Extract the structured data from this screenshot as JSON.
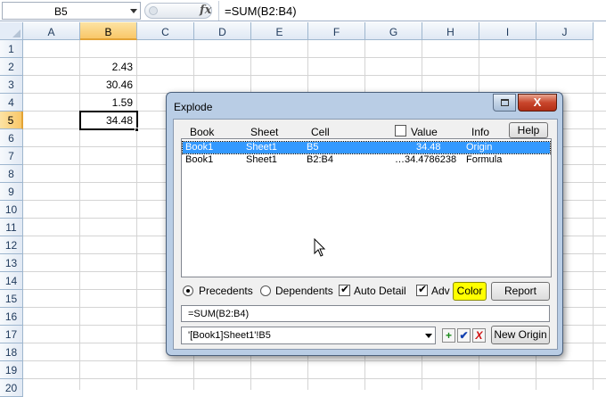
{
  "formula_bar": {
    "name_box": "B5",
    "fx_label": "fx",
    "formula": "=SUM(B2:B4)"
  },
  "sheet": {
    "columns": [
      "A",
      "B",
      "C",
      "D",
      "E",
      "F",
      "G",
      "H",
      "I",
      "J"
    ],
    "selected_column": "B",
    "rows": [
      "1",
      "2",
      "3",
      "4",
      "5",
      "6",
      "7",
      "8",
      "9",
      "10",
      "11",
      "12",
      "13",
      "14",
      "15",
      "16",
      "17",
      "18",
      "19",
      "20"
    ],
    "selected_row": "5",
    "cells": {
      "B2": "2.43",
      "B3": "30.46",
      "B4": "1.59",
      "B5": "34.48"
    }
  },
  "dialog": {
    "title": "Explode",
    "close_glyph": "X",
    "headers": {
      "book": "Book",
      "sheet": "Sheet",
      "cell": "Cell",
      "value": "Value",
      "info": "Info"
    },
    "help_label": "Help",
    "rows": [
      {
        "book": "Book1",
        "sheet": "Sheet1",
        "cell": "B5",
        "value": "34.48",
        "info": "Origin",
        "selected": true
      },
      {
        "book": "Book1",
        "sheet": "Sheet1",
        "cell": "B2:B4",
        "value": "…34.4786238",
        "info": "Formula",
        "selected": false
      }
    ],
    "options": {
      "precedents_label": "Precedents",
      "dependents_label": "Dependents",
      "auto_detail_label": "Auto Detail",
      "adv_label": "Adv",
      "color_label": "Color",
      "report_label": "Report"
    },
    "formula_text": "=SUM(B2:B4)",
    "address_value": "'[Book1]Sheet1'!B5",
    "plus_glyph": "+",
    "check_glyph": "✔",
    "x_glyph": "X",
    "new_origin_label": "New Origin"
  },
  "colors": {
    "selection_blue": "#3399ff",
    "color_button": "#ffff00",
    "header_highlight": "#f9c768"
  }
}
